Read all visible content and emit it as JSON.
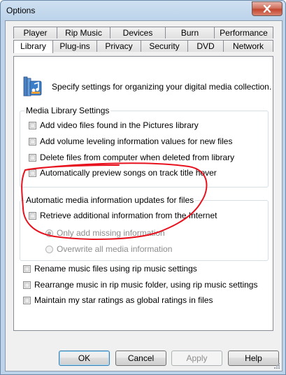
{
  "window": {
    "title": "Options"
  },
  "tabs": {
    "row1": [
      "Player",
      "Rip Music",
      "Devices",
      "Burn",
      "Performance"
    ],
    "row2": [
      "Library",
      "Plug-ins",
      "Privacy",
      "Security",
      "DVD",
      "Network"
    ],
    "active": "Library"
  },
  "intro": {
    "text": "Specify settings for organizing your digital media collection.",
    "icon": "media-library-icon"
  },
  "media_library_settings": {
    "legend": "Media Library Settings",
    "options": [
      {
        "label": "Add video files found in the Pictures library",
        "checked": false
      },
      {
        "label": "Add volume leveling information values for new files",
        "checked": false
      },
      {
        "label": "Delete files from computer when deleted from library",
        "checked": false
      },
      {
        "label": "Automatically preview songs on track title hover",
        "checked": false
      }
    ]
  },
  "auto_updates": {
    "legend": "Automatic media information updates for files",
    "retrieve": {
      "label": "Retrieve additional information from the Internet",
      "checked": false
    },
    "radio_options": [
      {
        "label": "Only add missing information",
        "selected": true,
        "enabled": false
      },
      {
        "label": "Overwrite all media information",
        "selected": false,
        "enabled": false
      }
    ]
  },
  "other_options": [
    {
      "label": "Rename music files using rip music settings",
      "checked": false
    },
    {
      "label": "Rearrange music in rip music folder, using rip music settings",
      "checked": false
    },
    {
      "label": "Maintain my star ratings as global ratings in files",
      "checked": false
    }
  ],
  "buttons": {
    "ok": "OK",
    "cancel": "Cancel",
    "apply": "Apply",
    "help": "Help"
  },
  "colors": {
    "annotation": "#e8121e",
    "title_bar": "#bcd3ea",
    "close": "#c4472f"
  }
}
